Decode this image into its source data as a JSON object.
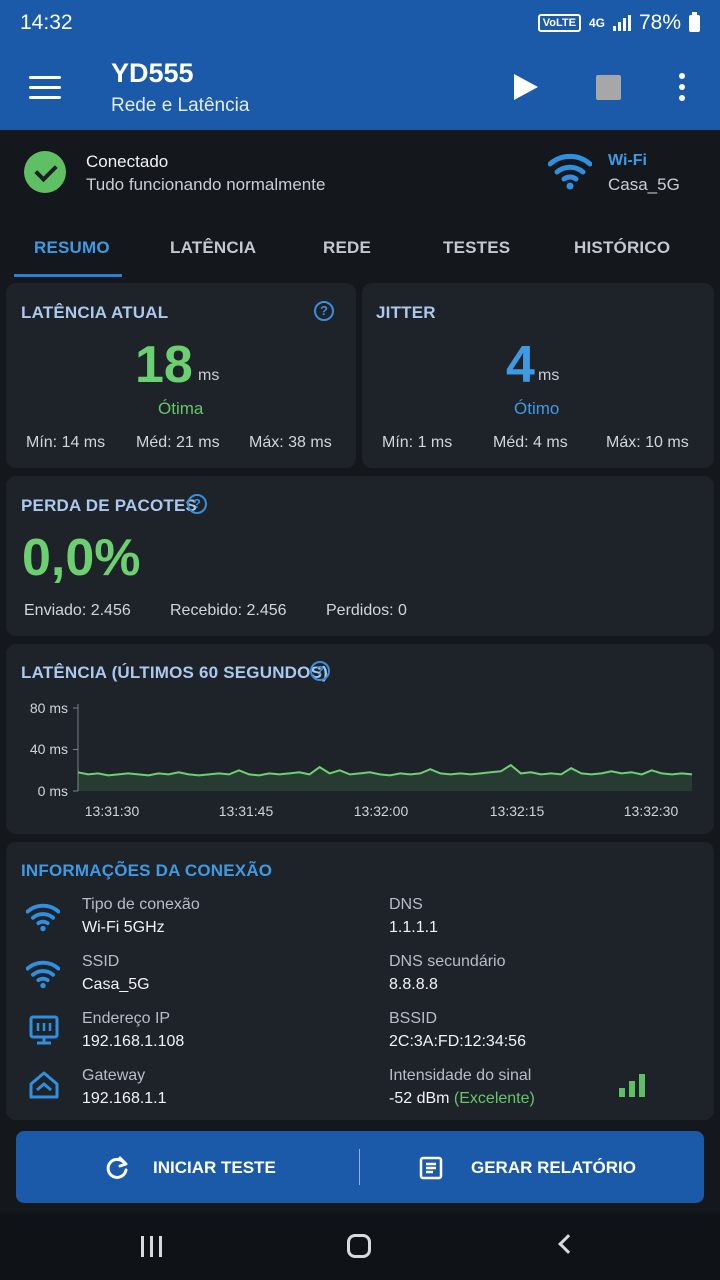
{
  "status_bar": {
    "time": "14:32",
    "volte": "VoLTE",
    "network": "4G",
    "battery": "78%"
  },
  "app_bar": {
    "title": "YD555",
    "subtitle": "Rede e Latência"
  },
  "connection": {
    "status": "Conectado",
    "detail": "Tudo funcionando normalmente",
    "type": "Wi-Fi",
    "ssid": "Casa_5G"
  },
  "tabs": [
    {
      "label": "RESUMO",
      "active": true
    },
    {
      "label": "LATÊNCIA",
      "active": false
    },
    {
      "label": "REDE",
      "active": false
    },
    {
      "label": "TESTES",
      "active": false
    },
    {
      "label": "HISTÓRICO",
      "active": false
    }
  ],
  "latency_card": {
    "title": "LATÊNCIA ATUAL",
    "value": "18",
    "unit": "ms",
    "rating": "Ótima",
    "min": "Mín: 14 ms",
    "avg": "Méd: 21 ms",
    "max": "Máx: 38 ms"
  },
  "jitter_card": {
    "title": "JITTER",
    "value": "4",
    "unit": "ms",
    "rating": "Ótimo",
    "min": "Mín: 1 ms",
    "avg": "Méd: 4 ms",
    "max": "Máx: 10 ms"
  },
  "packet_loss": {
    "title": "PERDA DE PACOTES",
    "value": "0,0%",
    "sent": "Enviado: 2.456",
    "received": "Recebido: 2.456",
    "lost": "Perdidos: 0"
  },
  "chart_title": "LATÊNCIA (ÚLTIMOS 60 SEGUNDOS)",
  "chart_data": {
    "type": "area",
    "title": "LATÊNCIA (ÚLTIMOS 60 SEGUNDOS)",
    "xlabel": "",
    "ylabel": "",
    "ylim": [
      0,
      80
    ],
    "yticks": [
      "80 ms",
      "40 ms",
      "0 ms"
    ],
    "xticks": [
      "13:31:30",
      "13:31:45",
      "13:32:00",
      "13:32:15",
      "13:32:30"
    ],
    "grid": false,
    "series": [
      {
        "values": [
          18,
          16,
          17,
          15,
          16,
          17,
          16,
          15,
          17,
          16,
          18,
          16,
          15,
          16,
          17,
          16,
          20,
          16,
          15,
          17,
          16,
          17,
          18,
          16,
          23,
          17,
          20,
          16,
          17,
          18,
          16,
          15,
          17,
          16,
          17,
          21,
          17,
          16,
          17,
          16,
          17,
          18,
          19,
          25,
          17,
          18,
          16,
          17,
          16,
          22,
          17,
          16,
          17,
          19,
          17,
          18,
          16,
          20,
          17,
          16,
          17,
          16
        ]
      }
    ],
    "color": "#6dd070"
  },
  "info": {
    "title": "INFORMAÇÕES DA CONEXÃO",
    "left": [
      {
        "label": "Tipo de conexão",
        "value": "Wi-Fi 5GHz"
      },
      {
        "label": "SSID",
        "value": "Casa_5G"
      },
      {
        "label": "Endereço IP",
        "value": "192.168.1.108"
      },
      {
        "label": "Gateway",
        "value": "192.168.1.1"
      }
    ],
    "right": [
      {
        "label": "DNS",
        "value": "1.1.1.1"
      },
      {
        "label": "DNS secundário",
        "value": "8.8.8.8"
      },
      {
        "label": "BSSID",
        "value": "2C:3A:FD:12:34:56"
      },
      {
        "label": "Intensidade do sinal",
        "value": "-52 dBm",
        "quality": "(Excelente)"
      }
    ]
  },
  "actions": {
    "start": "INICIAR TESTE",
    "report": "GERAR RELATÓRIO"
  },
  "colors": {
    "accent": "#1b59a9",
    "good": "#65c66a",
    "link": "#3b9be6"
  }
}
